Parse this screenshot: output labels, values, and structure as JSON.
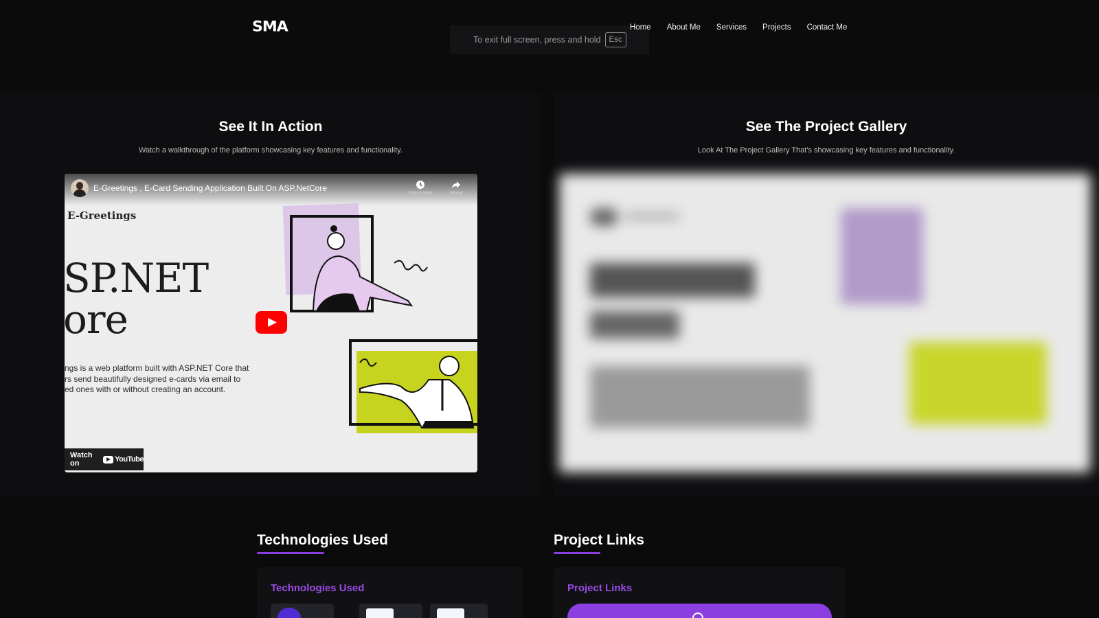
{
  "nav": {
    "logo": "SMA",
    "links": [
      "Home",
      "About Me",
      "Services",
      "Projects",
      "Contact Me"
    ]
  },
  "fullscreen_toast": {
    "message": "To exit full screen, press and hold",
    "key": "Esc"
  },
  "action": {
    "title": "See It In Action",
    "subtitle": "Watch a walkthrough of the platform showcasing key features and functionality.",
    "video": {
      "title": "E-Greetings , E-Card Sending Application Built On ASP.NetCore",
      "watch_later": "Watch later",
      "share": "Share",
      "brand": "E-Greetings",
      "big_line1": "SP.NET",
      "big_line2": "ore",
      "desc_line1": "ngs is a web platform built with ASP.NET Core that",
      "desc_line2": "rs send beautifully designed e-cards via email to",
      "desc_line3": "ed ones with or without creating an account.",
      "watch_on": "Watch on",
      "youtube": "YouTube"
    }
  },
  "gallery": {
    "title": "See The Project Gallery",
    "subtitle": "Look At The Project Gallery That's showcasing key features and functionality."
  },
  "technologies": {
    "section_title": "Technologies Used",
    "card_title": "Technologies Used"
  },
  "project_links": {
    "section_title": "Project Links",
    "card_title": "Project Links"
  },
  "colors": {
    "accent": "#8c3fe0",
    "accent_text": "#9a4be6",
    "background": "#0b0b0c",
    "lime": "#c8d62c",
    "lilac": "#d8b8e8"
  }
}
